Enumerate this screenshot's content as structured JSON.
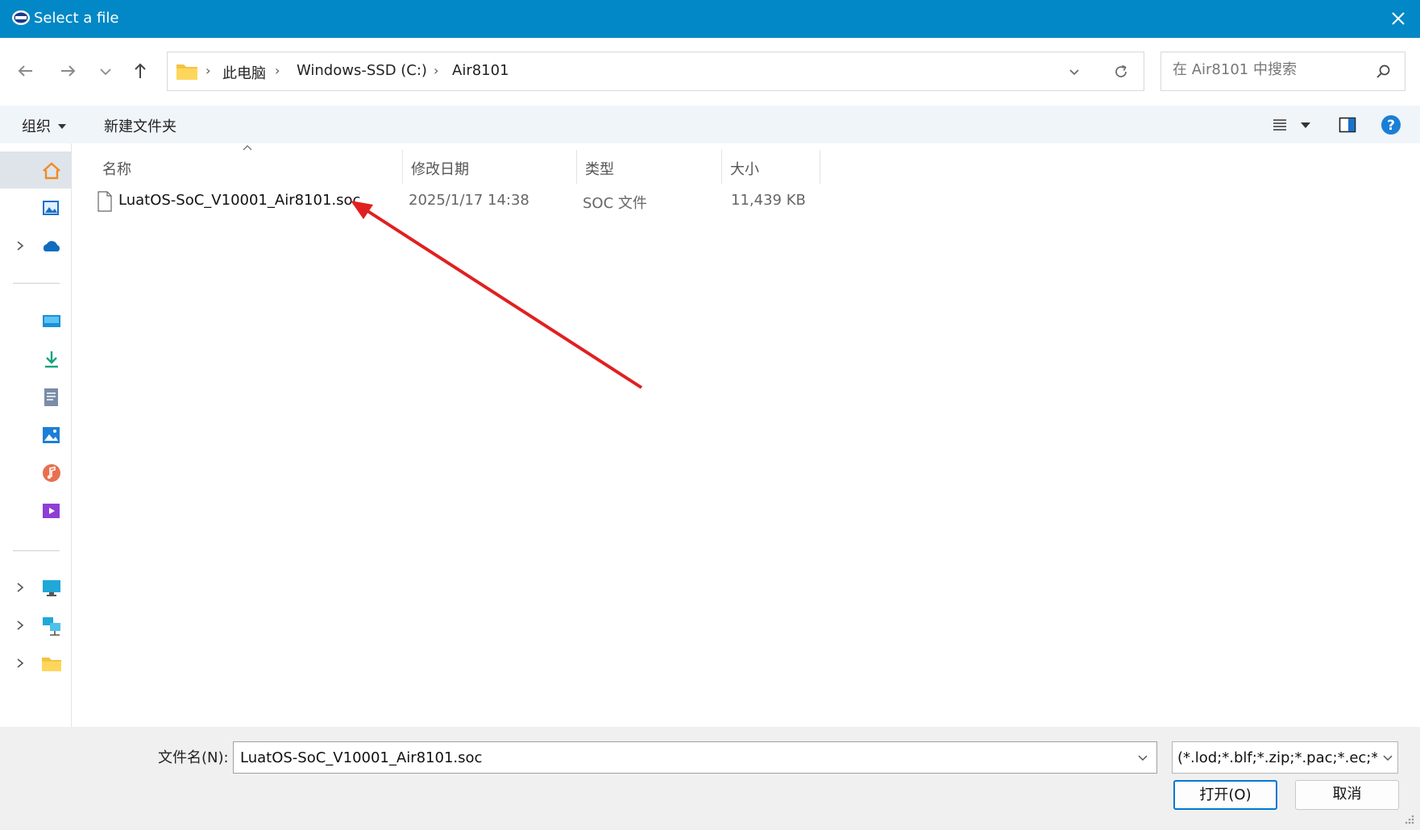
{
  "window": {
    "title": "Select a file",
    "accent_color": "#0288c6"
  },
  "nav": {
    "back_icon": "arrow-left-icon",
    "forward_icon": "arrow-right-icon",
    "recent_icon": "chevron-down-icon",
    "up_icon": "arrow-up-icon"
  },
  "address": {
    "crumbs": [
      "此电脑",
      "Windows-SSD (C:)",
      "Air8101"
    ]
  },
  "search": {
    "placeholder": "在 Air8101 中搜索"
  },
  "toolbar": {
    "organize_label": "组织",
    "new_folder_label": "新建文件夹"
  },
  "sidebar": {
    "icons": [
      "home-icon",
      "gallery-icon",
      "onedrive-icon",
      "desktop-icon",
      "downloads-icon",
      "documents-icon",
      "pictures-icon",
      "music-icon",
      "videos-icon",
      "this-pc-icon",
      "network-icon",
      "folder-icon"
    ]
  },
  "columns": {
    "name": "名称",
    "date": "修改日期",
    "type": "类型",
    "size": "大小"
  },
  "files": [
    {
      "name": "LuatOS-SoC_V10001_Air8101.soc",
      "date": "2025/1/17 14:38",
      "type": "SOC 文件",
      "size": "11,439 KB"
    }
  ],
  "footer": {
    "filename_label": "文件名(N):",
    "filename_value": "LuatOS-SoC_V10001_Air8101.soc",
    "filter_value": "(*.lod;*.blf;*.zip;*.pac;*.ec;*.st;",
    "open_label": "打开(O)",
    "cancel_label": "取消"
  },
  "annotation": {
    "arrow_color": "#e02020"
  }
}
